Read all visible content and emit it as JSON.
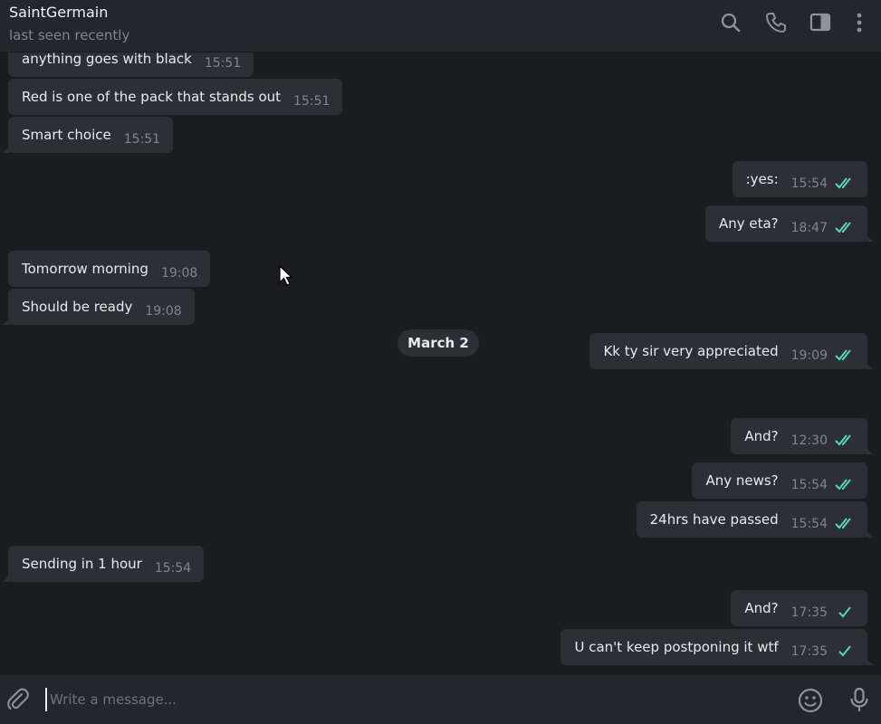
{
  "header": {
    "title": "SaintGermain",
    "status": "last seen recently"
  },
  "messages": [
    {
      "dir": "in",
      "text": "anything goes with black",
      "time": "15:51"
    },
    {
      "dir": "in",
      "text": "Red is one of the pack that stands out",
      "time": "15:51"
    },
    {
      "dir": "in",
      "text": "Smart choice",
      "time": "15:51"
    },
    {
      "dir": "out",
      "text": ":yes:",
      "time": "15:54",
      "read": true
    },
    {
      "dir": "out",
      "text": "Any eta?",
      "time": "18:47",
      "read": true
    },
    {
      "dir": "in",
      "text": "Tomorrow morning",
      "time": "19:08"
    },
    {
      "dir": "in",
      "text": "Should be ready",
      "time": "19:08"
    },
    {
      "dir": "out",
      "text": "Kk ty sir very appreciated",
      "time": "19:09",
      "read": true
    },
    {
      "dir": "out",
      "text": "And?",
      "time": "12:30",
      "read": true
    },
    {
      "dir": "out",
      "text": "Any news?",
      "time": "15:54",
      "read": true
    },
    {
      "dir": "out",
      "text": "24hrs have passed",
      "time": "15:54",
      "read": true
    },
    {
      "dir": "in",
      "text": "Sending in 1 hour",
      "time": "15:54"
    },
    {
      "dir": "out",
      "text": "And?",
      "time": "17:35",
      "read": false
    },
    {
      "dir": "out",
      "text": "U can't keep postponing it wtf",
      "time": "17:35",
      "read": false
    }
  ],
  "date_separator": "March 2",
  "composer": {
    "placeholder": "Write a message..."
  },
  "colors": {
    "accent": "#5ad5b8",
    "bubble": "#2c3036",
    "background": "#1b1c20",
    "header": "#23262c"
  },
  "icons": [
    "search-icon",
    "phone-icon",
    "sidebar-icon",
    "more-icon",
    "attach-icon",
    "emoji-icon",
    "microphone-icon"
  ]
}
